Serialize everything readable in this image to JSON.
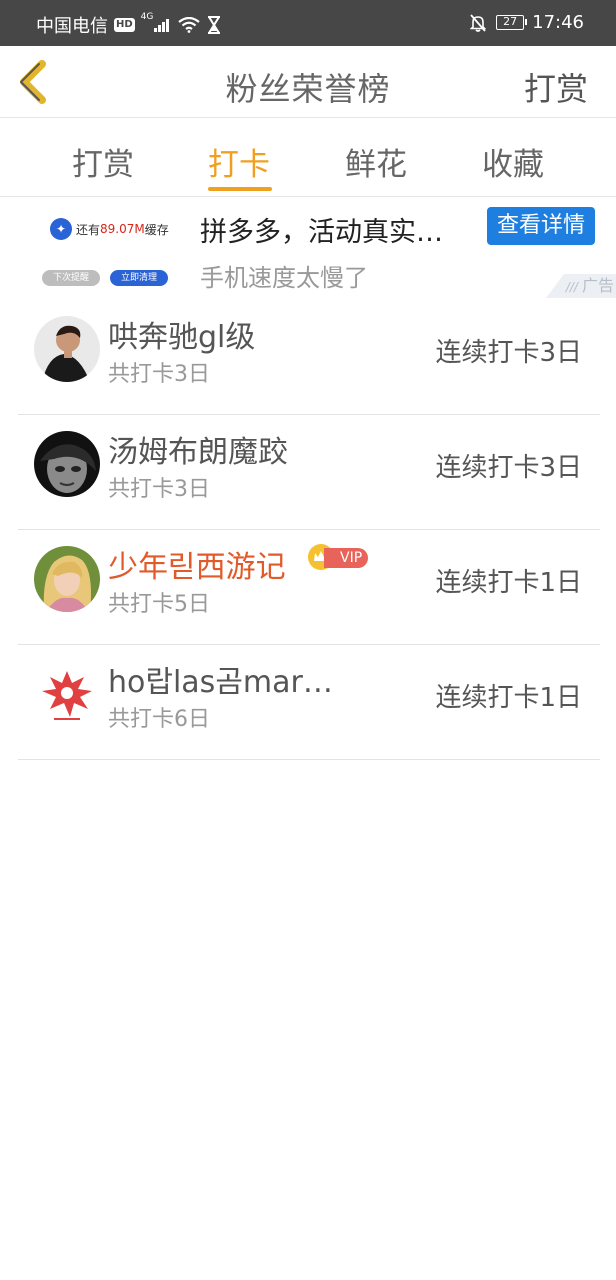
{
  "status_bar": {
    "carrier": "中国电信",
    "hd": "HD",
    "network": "4G",
    "battery": "27",
    "time": "17:46"
  },
  "nav": {
    "title": "粉丝荣誉榜",
    "action": "打赏"
  },
  "tabs": [
    {
      "label": "打赏"
    },
    {
      "label": "打卡"
    },
    {
      "label": "鲜花"
    },
    {
      "label": "收藏"
    }
  ],
  "active_tab": "打卡",
  "ad": {
    "thumb_text": "还有",
    "thumb_size": "89.07M",
    "thumb_suffix": "缓存",
    "thumb_pill1": "下次提醒",
    "thumb_pill2": "立即清理",
    "title": "拼多多，活动真实…",
    "subtitle": "手机速度太慢了",
    "button": "查看详情",
    "tag": "广告"
  },
  "rows": [
    {
      "name": "哄奔驰gl级",
      "total": "共打卡3日",
      "streak": "连续打卡3日"
    },
    {
      "name": "汤姆布朗魔跤",
      "total": "共打卡3日",
      "streak": "连续打卡3日"
    },
    {
      "name": "少年릳西游记",
      "total": "共打卡5日",
      "streak": "连续打卡1日",
      "vip_label": "VIP"
    },
    {
      "name": "ho랍las곰mar…",
      "total": "共打卡6日",
      "streak": "连续打卡1日"
    }
  ],
  "colors": {
    "accent": "#f0a020",
    "vip_name": "#e05a2a",
    "status_bar": "#474747",
    "ad_button": "#1f7fe0"
  }
}
